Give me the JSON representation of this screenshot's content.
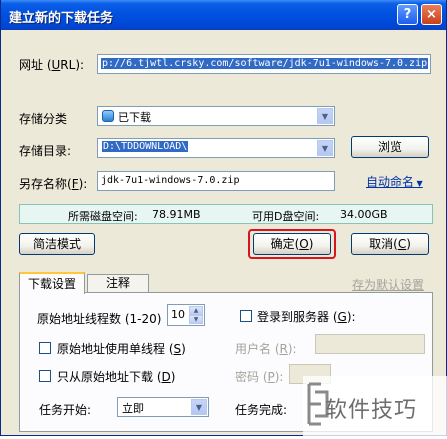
{
  "window": {
    "title": "建立新的下载任务"
  },
  "titlebar": {
    "help_glyph": "?",
    "close_glyph": "×"
  },
  "url": {
    "label_pre": "网址 (",
    "label_key": "U",
    "label_post": "RL):",
    "value": "p://6.tjwtl.crsky.com/software/jdk-7u1-windows-7.0.zip"
  },
  "category": {
    "label": "存储分类",
    "value": "已下载"
  },
  "directory": {
    "label": "存储目录:",
    "value": "D:\\TDDOWNLOAD\\",
    "browse_label": "浏览"
  },
  "saveas": {
    "label": "另存名称(",
    "label_key": "F",
    "label_post": "):",
    "value": "jdk-7u1-windows-7.0.zip",
    "auto_rename": "自动命名"
  },
  "disk": {
    "free_label": "所需磁盘空间:",
    "free_value": "78.91MB",
    "avail_label": "可用D盘空间:",
    "avail_value": "34.00GB"
  },
  "buttons": {
    "simple_mode": "简洁模式",
    "ok_label": "确定",
    "ok_key": "O",
    "cancel_label": "取消",
    "cancel_key": "C"
  },
  "tabs": [
    {
      "label": "下载设置"
    },
    {
      "label": "注释"
    }
  ],
  "save_default": "存为默认设置",
  "settings": {
    "threads_label": "原始地址线程数 (1-20)",
    "threads_value": "10",
    "login_label": "登录到服务器 (",
    "login_key": "G",
    "login_post": "):",
    "single_thread_label": "原始地址使用单线程 (",
    "single_thread_key": "S",
    "single_thread_post": ")",
    "only_origin_label": "只从原始地址下载 (",
    "only_origin_key": "D",
    "only_origin_post": ")",
    "username_label": "用户名 (",
    "username_key": "R",
    "username_post": "):",
    "password_label": "密码 (",
    "password_key": "P",
    "password_post": "):",
    "start_label": "任务开始:",
    "start_value": "立即",
    "finish_label": "任务完成:"
  },
  "watermark": {
    "text": "软件技巧"
  },
  "colors": {
    "titlebar": "#0050e0",
    "ok_highlight": "#d9141b",
    "auto_rename": "#0033aa"
  }
}
